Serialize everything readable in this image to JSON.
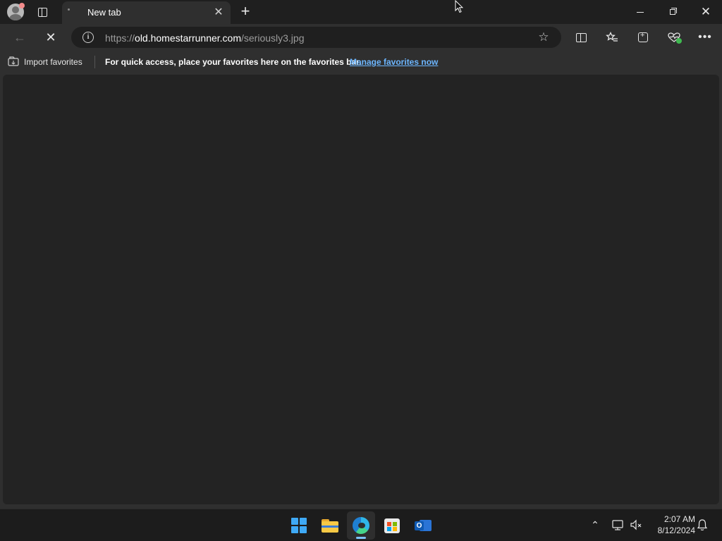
{
  "browser": {
    "tab": {
      "title": "New tab"
    },
    "address": {
      "protocol": "https://",
      "host": "old.homestarrunner.com",
      "path": "/seriously3.jpg"
    },
    "favorites_bar": {
      "import_label": "Import favorites",
      "message": "For quick access, place your favorites here on the favorites bar.",
      "manage_link": "Manage favorites now"
    },
    "icons": {
      "profile": "profile-avatar-icon",
      "tab_actions": "tab-actions-icon",
      "new_tab": "plus-icon",
      "back": "arrow-left-icon",
      "stop": "close-icon",
      "site_info": "info-icon",
      "favorite": "star-icon",
      "split_screen": "split-screen-icon",
      "favorites": "favorites-icon",
      "collections": "collections-icon",
      "browser_essentials": "heart-pulse-icon",
      "more": "ellipsis-icon"
    }
  },
  "taskbar": {
    "apps": [
      "Start",
      "File Explorer",
      "Microsoft Edge",
      "Microsoft Store",
      "Outlook"
    ],
    "clock": {
      "time": "2:07 AM",
      "date": "8/12/2024"
    }
  },
  "colors": {
    "page_background": "#1f1f1f",
    "toolbar": "#2f2f2f",
    "content": "#232323",
    "link": "#6cb6ff",
    "windows_accent": "#3fa9f5",
    "health_badge": "#3fb950"
  }
}
